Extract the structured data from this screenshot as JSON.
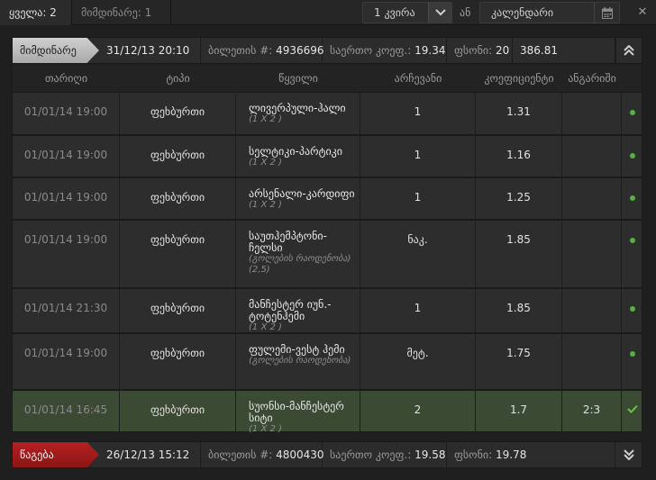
{
  "filters": {
    "tab_all": "ყველა: 2",
    "tab_current": "მიმდინარე: 1",
    "period_select": "1 კვირა",
    "or_label": "ან",
    "calendar_value": "კალენდარი"
  },
  "tickets": [
    {
      "status": "მიმდინარე",
      "datetime": "31/12/13 20:10",
      "ticket_label": "ბილეთის #:",
      "ticket_no": "4936696",
      "coef_label": "საერთო კოეფ.:",
      "coef": "19.34",
      "stake_label": "ფსონი:",
      "stake": "20",
      "payout": "386.81"
    },
    {
      "status": "წაგება",
      "datetime": "26/12/13 15:12",
      "ticket_label": "ბილეთის #:",
      "ticket_no": "4800430",
      "coef_label": "საერთო კოეფ.:",
      "coef": "19.58",
      "stake_label": "ფსონი:",
      "stake": "19.78"
    }
  ],
  "table": {
    "columns": [
      "თარიღი",
      "ტიპი",
      "წყვილი",
      "არჩევანი",
      "კოეფიციენტი",
      "ანგარიში"
    ],
    "rows": [
      {
        "date": "01/01/14 19:00",
        "type": "ფეხბურთი",
        "event": "ლივერპული-ჰალი",
        "market": "(1 X 2 )",
        "pick": "1",
        "odd": "1.31",
        "score": "",
        "status": "pending"
      },
      {
        "date": "01/01/14 19:00",
        "type": "ფეხბურთი",
        "event": "სელტიკი-პარტიკი",
        "market": "(1 X 2 )",
        "pick": "1",
        "odd": "1.16",
        "score": "",
        "status": "pending"
      },
      {
        "date": "01/01/14 19:00",
        "type": "ფეხბურთი",
        "event": "არსენალი-კარდიფი",
        "market": "(1 X 2 )",
        "pick": "1",
        "odd": "1.25",
        "score": "",
        "status": "pending"
      },
      {
        "date": "01/01/14 19:00",
        "type": "ფეხბურთი",
        "event": "საუთჰემპტონი-ჩელსი",
        "market": "(გოლების რაოდენობა) (2,5)",
        "pick": "ნაკ.",
        "odd": "1.85",
        "score": "",
        "status": "pending"
      },
      {
        "date": "01/01/14 21:30",
        "type": "ფეხბურთი",
        "event": "მანჩესტერ იუნ.-ტოტენჰემი",
        "market": "(1 X 2 )",
        "pick": "1",
        "odd": "1.85",
        "score": "",
        "status": "pending"
      },
      {
        "date": "01/01/14 19:00",
        "type": "ფეხბურთი",
        "event": "ფულემი-ვესტ ჰემი",
        "market": "(გოლების რაოდენობა)",
        "pick": "მეტ.",
        "odd": "1.75",
        "score": "",
        "status": "pending"
      },
      {
        "date": "01/01/14 16:45",
        "type": "ფეხბურთი",
        "event": "სუონსი-მანჩესტერ სიტი",
        "market": "(1 X 2 )",
        "pick": "2",
        "odd": "1.7",
        "score": "2:3",
        "status": "won"
      }
    ]
  },
  "colors": {
    "pending_dot": "#56b23a",
    "won_row": "#3b4a33",
    "lost_badge": "#b52121",
    "current_badge": "#bdbdbd"
  }
}
